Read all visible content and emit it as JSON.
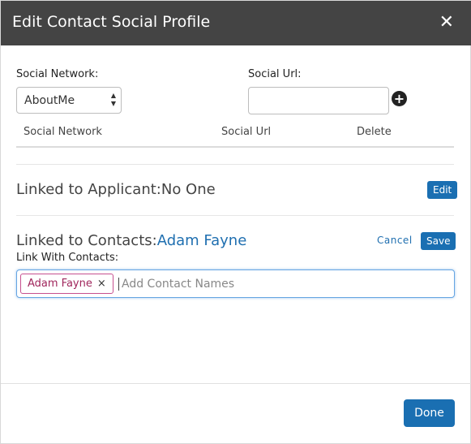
{
  "modal": {
    "title": "Edit Contact Social Profile",
    "close_glyph": "✕"
  },
  "form": {
    "social_network_label": "Social Network:",
    "social_network_value": "AboutMe",
    "social_url_label": "Social Url:",
    "social_url_value": "",
    "add_icon_glyph": "+"
  },
  "table": {
    "columns": [
      "Social Network",
      "Social Url",
      "Delete"
    ],
    "rows": []
  },
  "applicant": {
    "label": "Linked to Applicant:",
    "value": "No One",
    "edit_label": "Edit"
  },
  "contacts": {
    "label": "Linked to Contacts:",
    "value": "Adam Fayne",
    "cancel_label": "Cancel",
    "save_label": "Save",
    "link_with_label": "Link With Contacts:",
    "chips": [
      "Adam Fayne"
    ],
    "chip_remove_glyph": "×",
    "placeholder": "Add Contact Names"
  },
  "footer": {
    "done_label": "Done"
  },
  "colors": {
    "header_bg": "#444444",
    "primary": "#1a6fb2",
    "accent_text": "#1f6fb0",
    "chip_border": "#c6508f",
    "chip_text": "#a0265c"
  }
}
